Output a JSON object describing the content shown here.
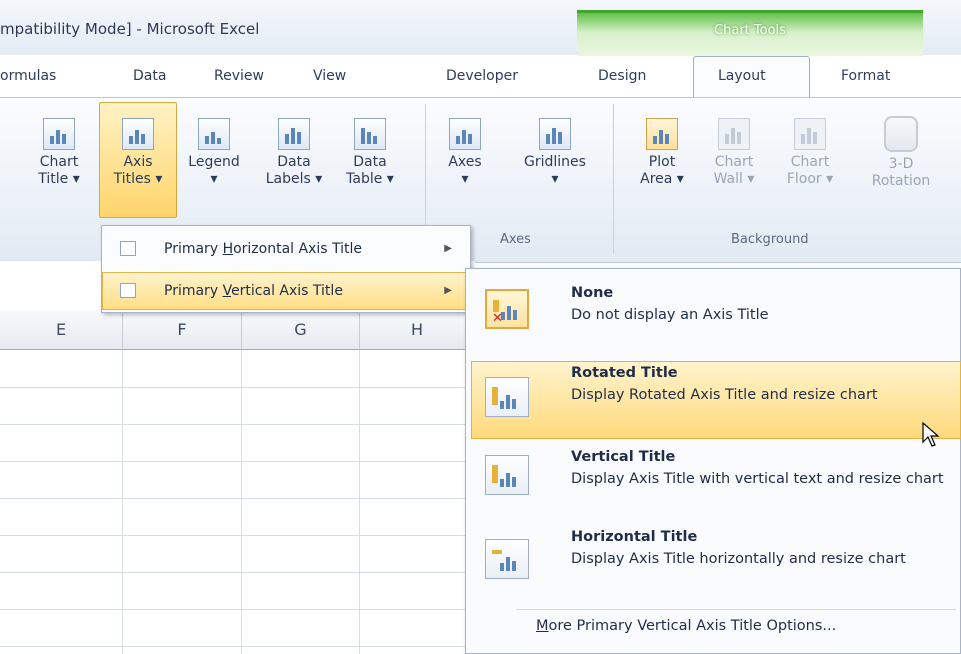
{
  "window": {
    "title": "mpatibility Mode] - Microsoft Excel"
  },
  "context_tab_group": {
    "label": "Chart Tools"
  },
  "tabs": [
    {
      "label": "ormulas"
    },
    {
      "label": "Data"
    },
    {
      "label": "Review"
    },
    {
      "label": "View"
    },
    {
      "label": "Developer"
    },
    {
      "label": "Design"
    },
    {
      "label": "Layout",
      "active": true
    },
    {
      "label": "Format"
    }
  ],
  "ribbon": {
    "labels_group": {
      "chart_title": [
        "Chart",
        "Title ▾"
      ],
      "axis_titles": [
        "Axis",
        "Titles ▾"
      ],
      "legend": [
        "Legend",
        "▾"
      ],
      "data_labels": [
        "Data",
        "Labels ▾"
      ],
      "data_table": [
        "Data",
        "Table ▾"
      ]
    },
    "axes_group": {
      "label": "Axes",
      "axes": [
        "Axes",
        "▾"
      ],
      "gridlines": [
        "Gridlines",
        "▾"
      ]
    },
    "background_group": {
      "label": "Background",
      "plot_area": [
        "Plot",
        "Area ▾"
      ],
      "chart_wall": [
        "Chart",
        "Wall ▾"
      ],
      "chart_floor": [
        "Chart",
        "Floor ▾"
      ],
      "rotation_3d": [
        "3-D",
        "Rotation"
      ]
    }
  },
  "columns": [
    "E",
    "F",
    "G",
    "H"
  ],
  "axis_titles_menu": {
    "items": [
      {
        "pre": "Primary ",
        "key": "H",
        "post": "orizontal Axis Title"
      },
      {
        "pre": "Primary ",
        "key": "V",
        "post": "ertical Axis Title"
      }
    ]
  },
  "vertical_title_gallery": {
    "items": [
      {
        "title": "None",
        "desc": "Do not display an Axis Title"
      },
      {
        "title": "Rotated Title",
        "desc": "Display Rotated Axis Title and resize chart"
      },
      {
        "title": "Vertical Title",
        "desc": "Display Axis Title with vertical text and resize chart"
      },
      {
        "title": "Horizontal Title",
        "desc": "Display Axis Title horizontally and resize chart"
      }
    ],
    "more": {
      "key": "M",
      "rest": "ore Primary Vertical Axis Title Options..."
    }
  },
  "colors": {
    "accent": "#ffd56b",
    "chart_tools": "#63c14c"
  }
}
